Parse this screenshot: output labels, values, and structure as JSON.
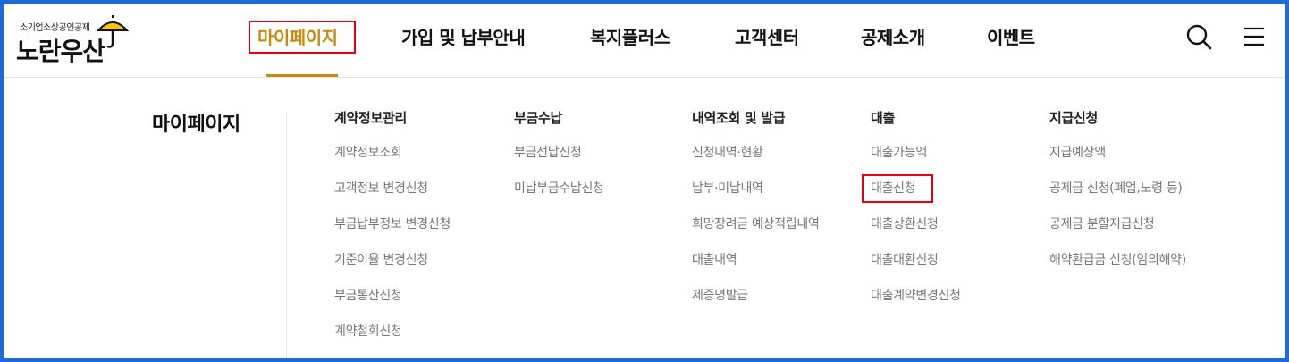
{
  "logo": {
    "subtitle": "소기업소상공인공제",
    "name": "노란우산",
    "mark": "J"
  },
  "colors": {
    "accent": "#c8890f",
    "highlight_border": "#e60012",
    "frame": "#1f6ad9",
    "umbrella": "#f7c600"
  },
  "nav": {
    "items": [
      {
        "label": "마이페이지",
        "active": true
      },
      {
        "label": "가입 및 납부안내",
        "active": false
      },
      {
        "label": "복지플러스",
        "active": false
      },
      {
        "label": "고객센터",
        "active": false
      },
      {
        "label": "공제소개",
        "active": false
      },
      {
        "label": "이벤트",
        "active": false
      }
    ],
    "icons": [
      "search-icon",
      "hamburger-menu-icon"
    ]
  },
  "mega_menu": {
    "title": "마이페이지",
    "columns": [
      {
        "heading": "계약정보관리",
        "items": [
          "계약정보조회",
          "고객정보 변경신청",
          "부금납부정보 변경신청",
          "기준이율 변경신청",
          "부금통산신청",
          "계약철회신청"
        ]
      },
      {
        "heading": "부금수납",
        "items": [
          "부금선납신청",
          "미납부금수납신청"
        ]
      },
      {
        "heading": "내역조회 및 발급",
        "items": [
          "신청내역·현황",
          "납부·미납내역",
          "희망장려금 예상적립내역",
          "대출내역",
          "제증명발급"
        ]
      },
      {
        "heading": "대출",
        "items": [
          "대출가능액",
          "대출신청",
          "대출상환신청",
          "대출대환신청",
          "대출계약변경신청"
        ]
      },
      {
        "heading": "지급신청",
        "items": [
          "지급예상액",
          "공제금 신청(폐업,노령 등)",
          "공제금 분할지급신청",
          "해약환급금 신청(임의해약)"
        ]
      }
    ]
  }
}
